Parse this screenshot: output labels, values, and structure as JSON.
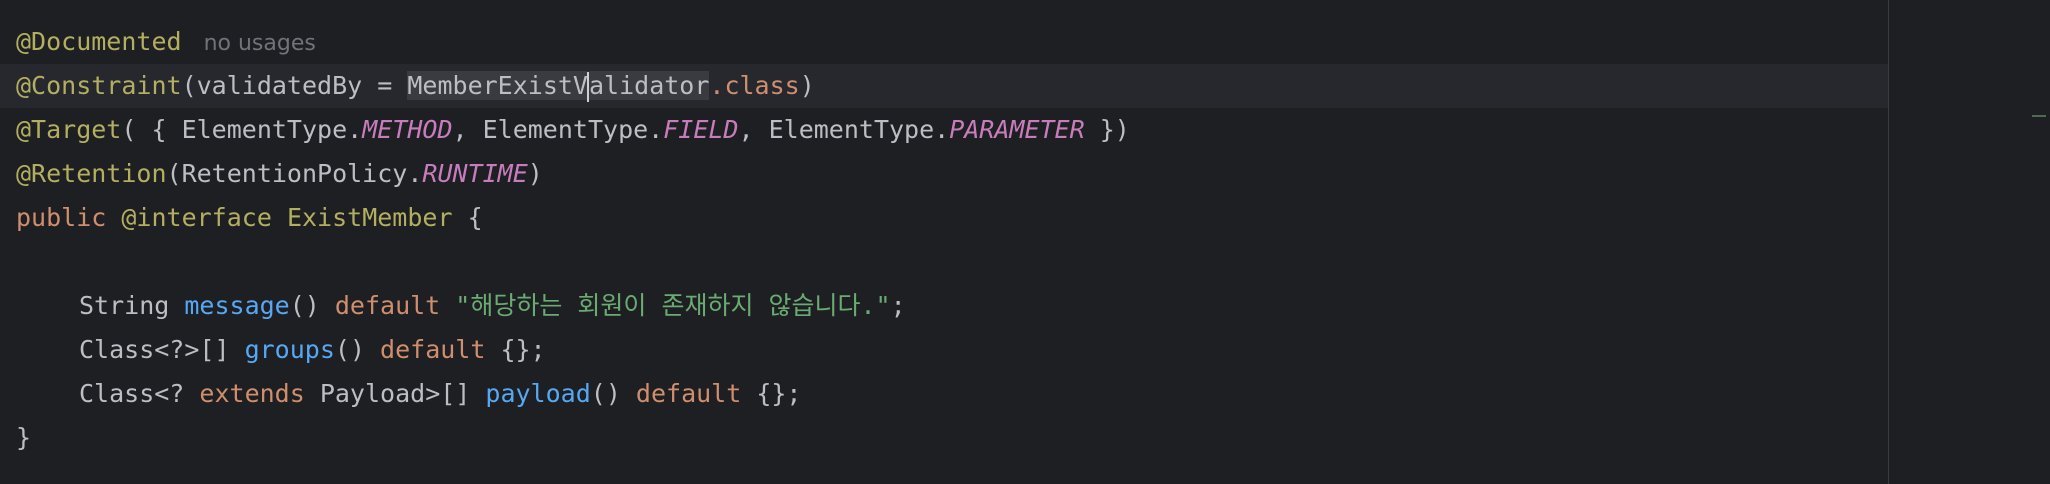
{
  "editor": {
    "usage_hint": "no usages",
    "lines": {
      "l1": {
        "annotation": "@Documented"
      },
      "l2": {
        "annotation": "@Constraint",
        "open": "(validatedBy = ",
        "class_before_caret": "MemberExistV",
        "class_after_caret": "alidator",
        "dot_class": ".class",
        "close": ")"
      },
      "l3": {
        "annotation": "@Target",
        "p1": "( { ElementType.",
        "f1": "METHOD",
        "p2": ", ElementType.",
        "f2": "FIELD",
        "p3": ", ElementType.",
        "f3": "PARAMETER",
        "p4": " })"
      },
      "l4": {
        "annotation": "@Retention",
        "p1": "(RetentionPolicy.",
        "f1": "RUNTIME",
        "p2": ")"
      },
      "l5": {
        "kw1": "public",
        "kw2": "@interface",
        "name": "ExistMember",
        "brace": " {"
      },
      "l7": {
        "type": "String ",
        "method": "message",
        "parens": "() ",
        "kw": "default",
        "string": "\"해당하는 회원이 존재하지 않습니다.\"",
        "end": ";"
      },
      "l8": {
        "type": "Class<?>[] ",
        "method": "groups",
        "parens": "() ",
        "kw": "default",
        "end": " {};"
      },
      "l9": {
        "type1": "Class<? ",
        "kw1": "extends",
        "type2": " Payload>[] ",
        "method": "payload",
        "parens": "() ",
        "kw2": "default",
        "end": " {};"
      },
      "l10": {
        "brace": "}"
      }
    }
  }
}
